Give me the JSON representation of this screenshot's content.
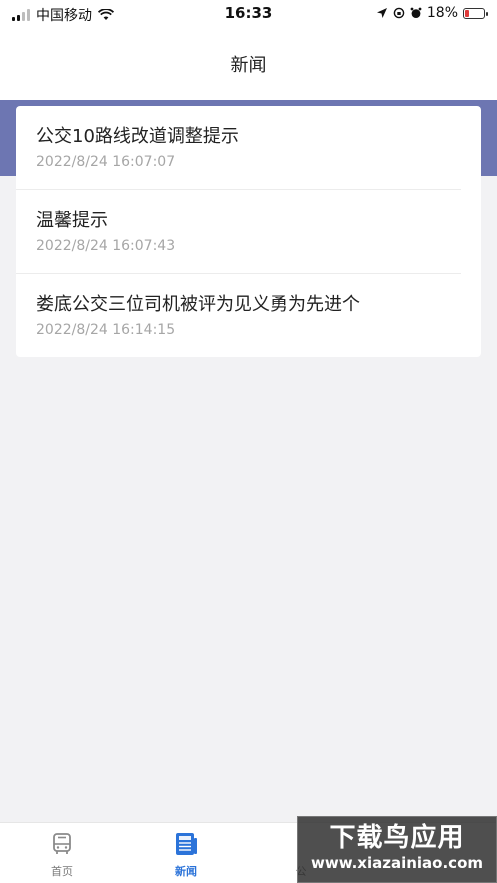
{
  "status_bar": {
    "carrier": "中国移动",
    "time": "16:33",
    "battery": "18%"
  },
  "nav": {
    "title": "新闻"
  },
  "news": [
    {
      "title": "公交10路线改道调整提示",
      "time": "2022/8/24 16:07:07"
    },
    {
      "title": "温馨提示",
      "time": "2022/8/24 16:07:43"
    },
    {
      "title": "娄底公交三位司机被评为见义勇为先进个",
      "time": "2022/8/24 16:14:15"
    }
  ],
  "tabs": [
    {
      "label": "首页",
      "icon": "bus-icon",
      "active": false
    },
    {
      "label": "新闻",
      "icon": "news-icon",
      "active": true
    },
    {
      "label": "公",
      "icon": "unknown-icon",
      "active": false
    }
  ],
  "watermark": {
    "main": "下载鸟应用",
    "sub": "www.xiazainiao.com"
  },
  "colors": {
    "accent_band": "#6d76b2",
    "tab_active": "#2b73d9",
    "background": "#f2f2f4"
  }
}
